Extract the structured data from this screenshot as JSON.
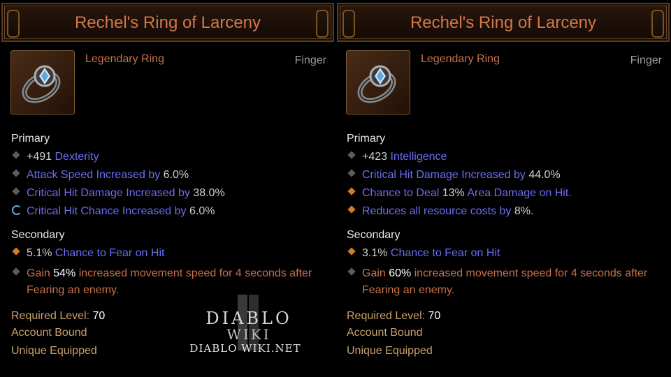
{
  "left": {
    "title": "Rechel's Ring of Larceny",
    "item_type": "Legendary Ring",
    "slot": "Finger",
    "primary_label": "Primary",
    "primary": [
      {
        "value": "+491",
        "text": " Dexterity"
      },
      {
        "text": "Attack Speed Increased by ",
        "value": "6.0%"
      },
      {
        "text": "Critical Hit Damage Increased by ",
        "value": "38.0%"
      },
      {
        "text": "Critical Hit Chance Increased by ",
        "value": "6.0%"
      }
    ],
    "secondary_label": "Secondary",
    "secondary": [
      {
        "value": "5.1%",
        "text": " Chance to Fear on Hit"
      }
    ],
    "legendary_affix": {
      "pre": "Gain ",
      "value": "54%",
      "post": " increased movement speed for 4 seconds after",
      "line2": "Fearing an enemy."
    },
    "required_level_label": "Required Level: ",
    "required_level": "70",
    "account_bound": "Account Bound",
    "unique_equipped": "Unique Equipped"
  },
  "right": {
    "title": "Rechel's Ring of Larceny",
    "item_type": "Legendary Ring",
    "slot": "Finger",
    "primary_label": "Primary",
    "primary": [
      {
        "value": "+423",
        "text": " Intelligence"
      },
      {
        "text": "Critical Hit Damage Increased by ",
        "value": "44.0%"
      },
      {
        "pre": "Chance to Deal ",
        "value": "13%",
        "post": " Area Damage on Hit."
      },
      {
        "text": "Reduces all resource costs by ",
        "value": "8%",
        "post": "."
      }
    ],
    "secondary_label": "Secondary",
    "secondary": [
      {
        "value": "3.1%",
        "text": " Chance to Fear on Hit"
      }
    ],
    "legendary_affix": {
      "pre": "Gain ",
      "value": "60%",
      "post": " increased movement speed for 4 seconds after",
      "line2": "Fearing an enemy."
    },
    "required_level_label": "Required Level: ",
    "required_level": "70",
    "account_bound": "Account Bound",
    "unique_equipped": "Unique Equipped"
  },
  "watermark": {
    "line1": "DIABLO",
    "line2": "WIKI",
    "line3": "DIABLO WIKI.NET"
  },
  "colors": {
    "title": "#d2784a",
    "magic_blue": "#6c6cf5",
    "legendary_orange": "#c9704b",
    "meta_tan": "#c9a06b"
  },
  "icons": [
    "ring-icon",
    "gray-diamond-bullet",
    "orange-diamond-bullet",
    "blue-swirl-bullet"
  ]
}
